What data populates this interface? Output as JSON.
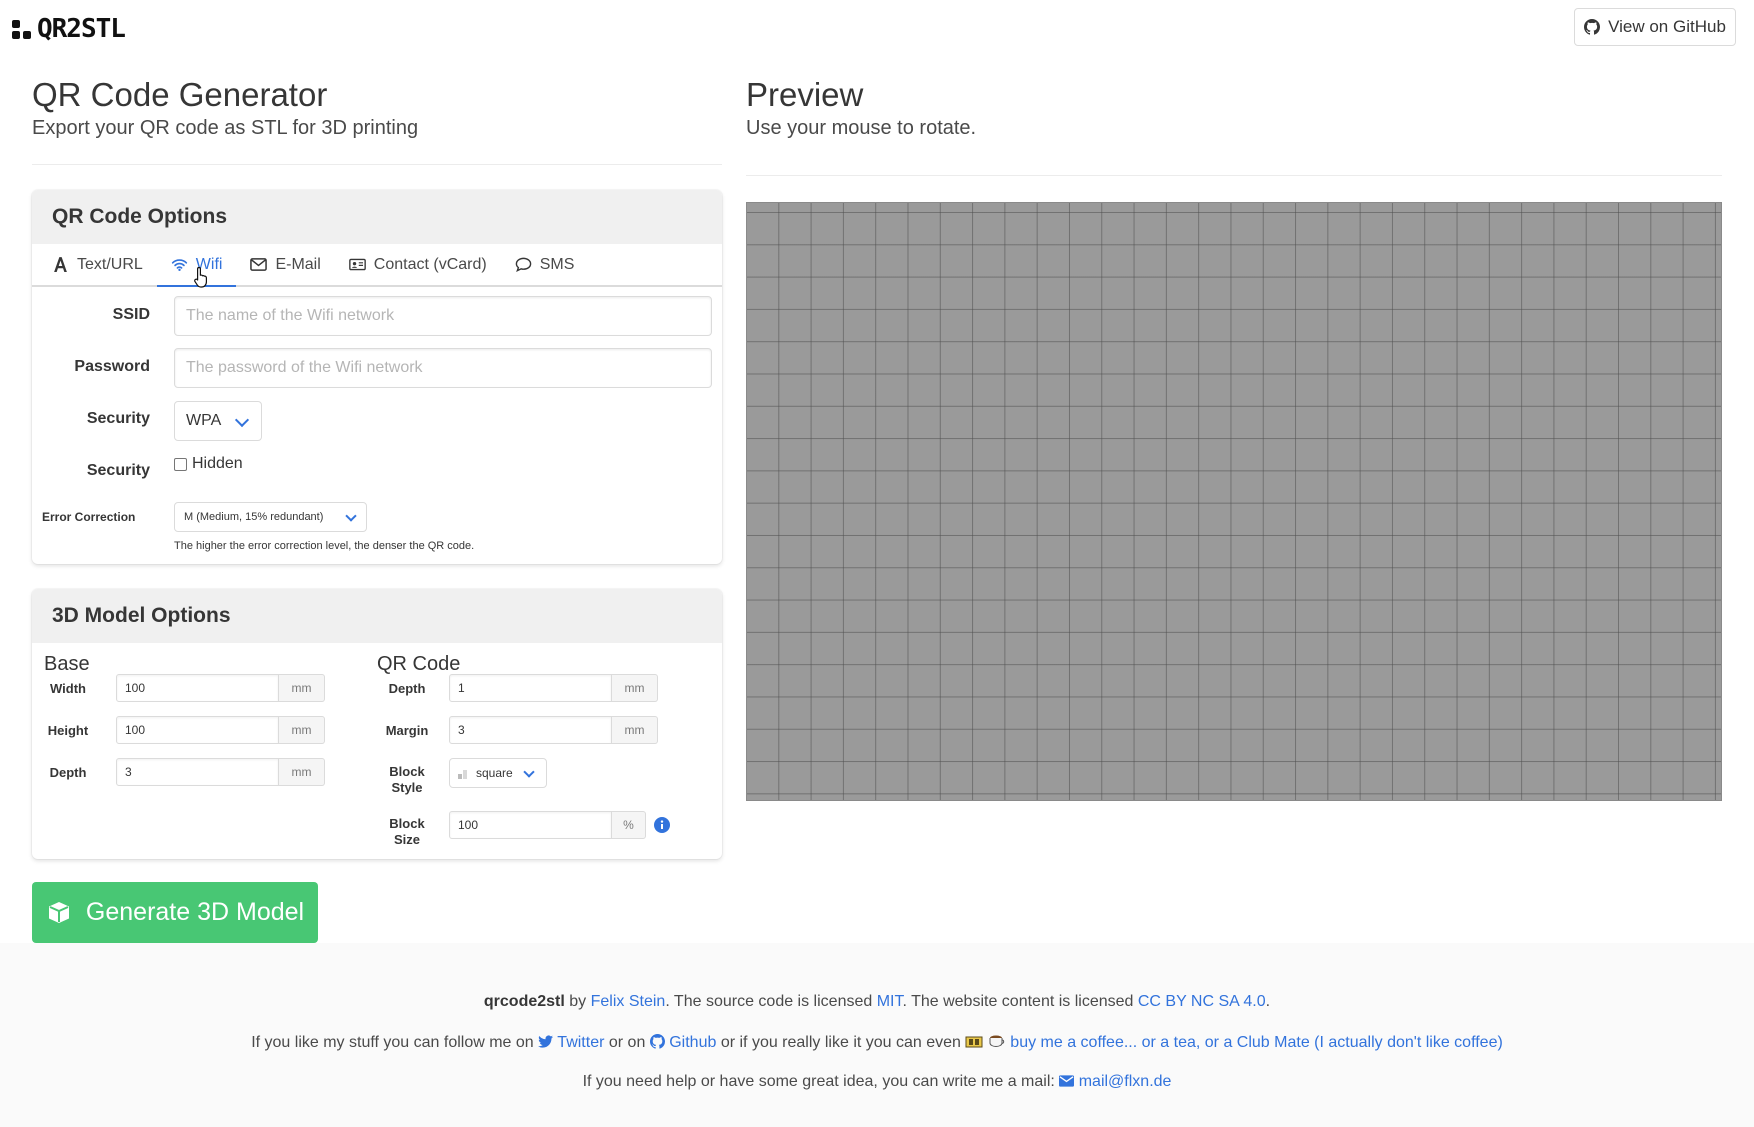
{
  "brand": {
    "logo_text": "QR2STL"
  },
  "header": {
    "github_button": "View on GitHub"
  },
  "left": {
    "title": "QR Code Generator",
    "subtitle": "Export your QR code as STL for 3D printing"
  },
  "right": {
    "title": "Preview",
    "subtitle": "Use your mouse to rotate."
  },
  "qr_options": {
    "heading": "QR Code Options",
    "tabs": [
      {
        "label": "Text/URL",
        "icon": "font-icon"
      },
      {
        "label": "Wifi",
        "icon": "wifi-icon",
        "active": true
      },
      {
        "label": "E-Mail",
        "icon": "envelope-icon"
      },
      {
        "label": "Contact (vCard)",
        "icon": "id-card-icon"
      },
      {
        "label": "SMS",
        "icon": "comment-icon"
      }
    ],
    "ssid": {
      "label": "SSID",
      "placeholder": "The name of the Wifi network",
      "value": ""
    },
    "password": {
      "label": "Password",
      "placeholder": "The password of the Wifi network",
      "value": ""
    },
    "security": {
      "label": "Security",
      "value": "WPA"
    },
    "hidden": {
      "label": "Security",
      "checkbox_label": "Hidden",
      "checked": false
    },
    "error_correction": {
      "label": "Error Correction",
      "value": "M (Medium, 15% redundant)",
      "help": "The higher the error correction level, the denser the QR code."
    }
  },
  "model_options": {
    "heading": "3D Model Options",
    "base": {
      "title": "Base",
      "width": {
        "label": "Width",
        "value": "100",
        "unit": "mm"
      },
      "height": {
        "label": "Height",
        "value": "100",
        "unit": "mm"
      },
      "depth": {
        "label": "Depth",
        "value": "3",
        "unit": "mm"
      }
    },
    "qr": {
      "title": "QR Code",
      "depth": {
        "label": "Depth",
        "value": "1",
        "unit": "mm"
      },
      "margin": {
        "label": "Margin",
        "value": "3",
        "unit": "mm"
      },
      "block_style": {
        "label_1": "Block",
        "label_2": "Style",
        "value": "square"
      },
      "block_size": {
        "label_1": "Block",
        "label_2": "Size",
        "value": "100",
        "unit": "%"
      }
    }
  },
  "generate_button": "Generate 3D Model",
  "footer": {
    "line1": {
      "name": "qrcode2stl",
      "by": " by ",
      "author": "Felix Stein",
      "t1": ". The source code is licensed ",
      "mit": "MIT",
      "t2": ". The website content is licensed ",
      "cc": "CC BY NC SA 4.0",
      "t3": "."
    },
    "line2": {
      "t1": "If you like my stuff you can follow me on ",
      "twitter": "Twitter",
      "t2": " or on ",
      "github": "Github",
      "t3": " or if you really like it you can even ",
      "coffee": "buy me a coffee... or a tea, or a Club Mate (I actually don't like coffee)"
    },
    "line3": {
      "t1": "If you need help or have some great idea, you can write me a mail: ",
      "mail": "mail@flxn.de"
    }
  },
  "colors": {
    "link": "#3273dc",
    "success": "#48c774",
    "preview_bg": "#9a9a9a"
  }
}
